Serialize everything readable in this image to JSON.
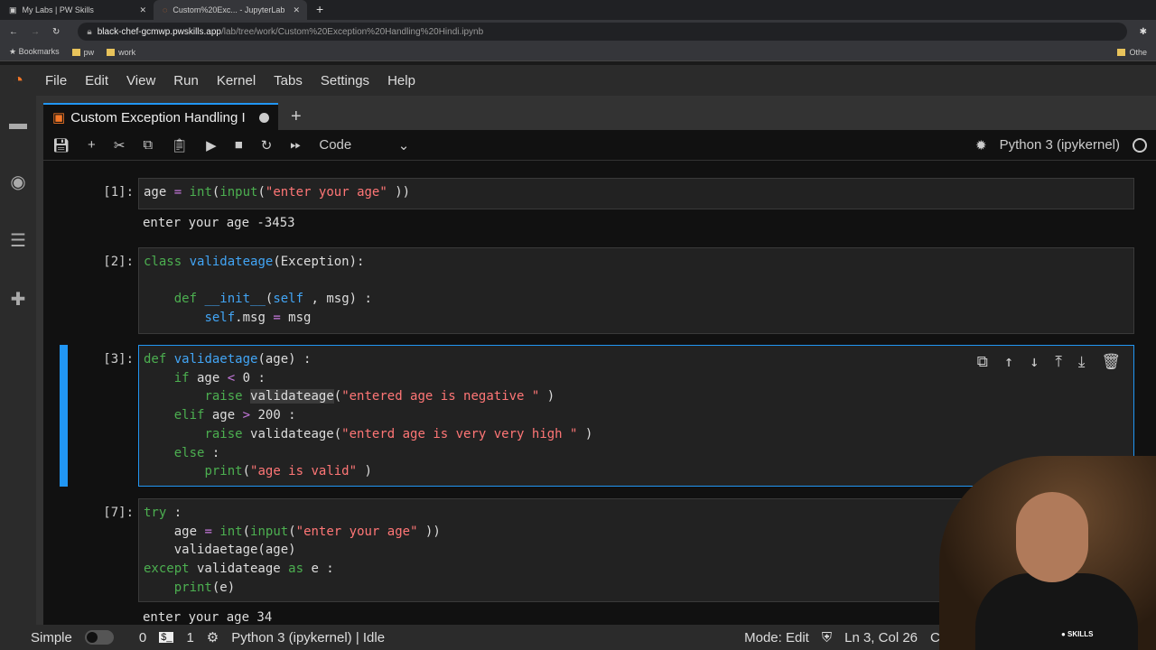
{
  "browser": {
    "tabs": [
      {
        "label": "My Labs | PW Skills",
        "active": false
      },
      {
        "label": "Custom%20Exc... - JupyterLab",
        "active": true
      }
    ],
    "url_host": "black-chef-gcmwp.pwskills.app",
    "url_path": "/lab/tree/work/Custom%20Exception%20Handling%20Hindi.ipynb",
    "bookmarks": [
      "Bookmarks",
      "pw",
      "work"
    ],
    "other_bookmarks": "Othe"
  },
  "menu": [
    "File",
    "Edit",
    "View",
    "Run",
    "Kernel",
    "Tabs",
    "Settings",
    "Help"
  ],
  "notebook": {
    "tab_title": "Custom Exception Handling I",
    "cell_type": "Code",
    "kernel": "Python 3 (ipykernel)"
  },
  "cells": [
    {
      "prompt": "[1]:",
      "output": "enter your age -3453"
    },
    {
      "prompt": "[2]:"
    },
    {
      "prompt": "[3]:"
    },
    {
      "prompt": "[7]:",
      "output": "enter your age 34"
    }
  ],
  "status": {
    "mode_label": "Simple",
    "count0": "0",
    "count1": "1",
    "kernel_status": "Python 3 (ipykernel) | Idle",
    "mode": "Mode: Edit",
    "cursor": "Ln 3, Col 26",
    "extra": "Cu"
  },
  "webcam": {
    "logo_text": "SKILLS"
  }
}
